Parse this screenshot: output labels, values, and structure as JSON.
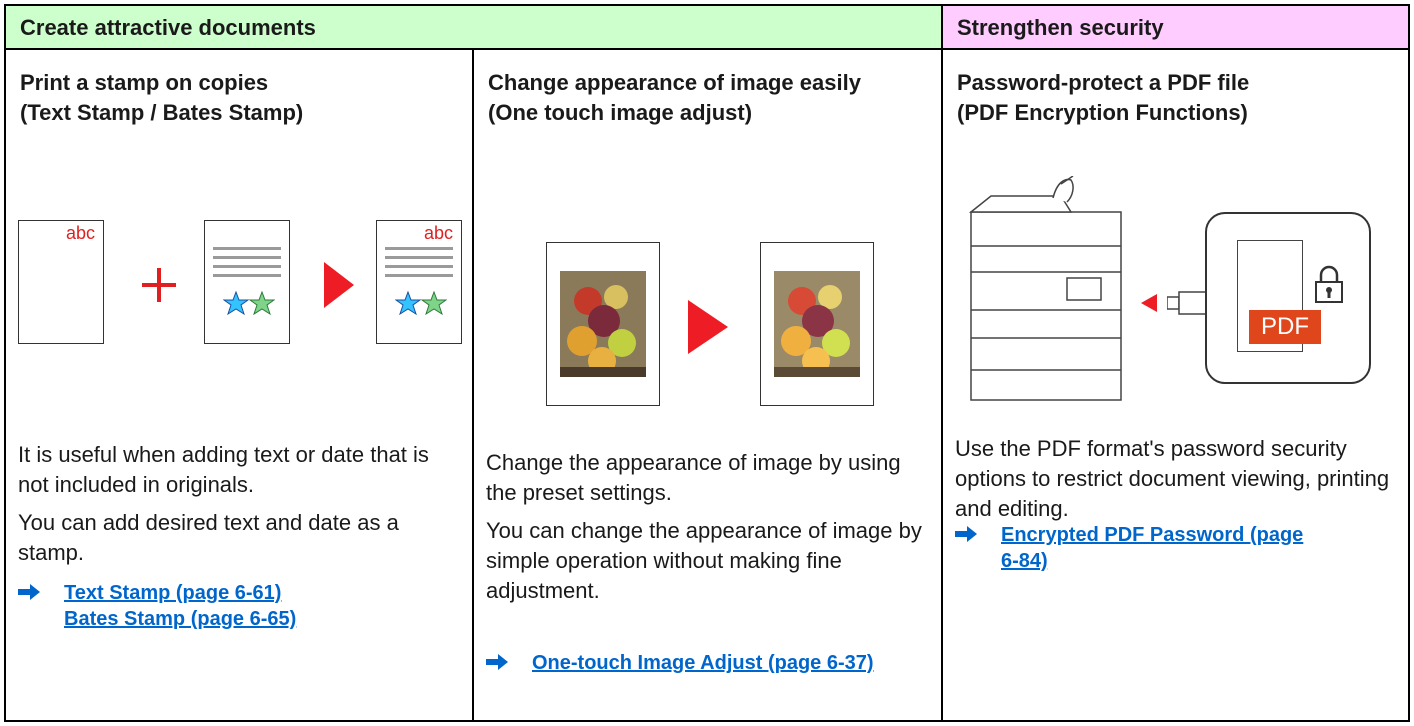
{
  "headers": {
    "create": "Create attractive documents",
    "security": "Strengthen security"
  },
  "col1": {
    "title_line1": "Print a stamp on copies",
    "title_line2": "(Text Stamp / Bates Stamp)",
    "stamp_text": "abc",
    "desc1": "It is useful when adding text or date that is not included in originals.",
    "desc2": "You can add desired text and date as a stamp.",
    "link1": "Text Stamp (page 6-61)",
    "link2": "Bates Stamp (page 6-65)"
  },
  "col2": {
    "title_line1": "Change appearance of image easily",
    "title_line2": "(One touch image adjust)",
    "desc1": "Change the appearance of image by using the preset settings.",
    "desc2": "You can change the appearance of image by simple operation without making fine adjustment.",
    "link1": "One-touch Image Adjust (page 6-37)"
  },
  "col3": {
    "title_line1": "Password-protect a PDF file",
    "title_line2": "(PDF Encryption Functions)",
    "pdf_label": "PDF",
    "desc1": "Use the PDF format's password security options to restrict document viewing, printing and editing.",
    "link1": "Encrypted PDF Password (page 6-84)"
  },
  "colors": {
    "create_header": "#ccffcc",
    "security_header": "#ffccff",
    "link": "#0066cc",
    "accent_red": "#e02020"
  },
  "icons": [
    "plus-icon",
    "play-arrow-icon",
    "star-icon",
    "link-arrow-icon",
    "lock-icon",
    "usb-drive-icon",
    "printer-icon"
  ]
}
